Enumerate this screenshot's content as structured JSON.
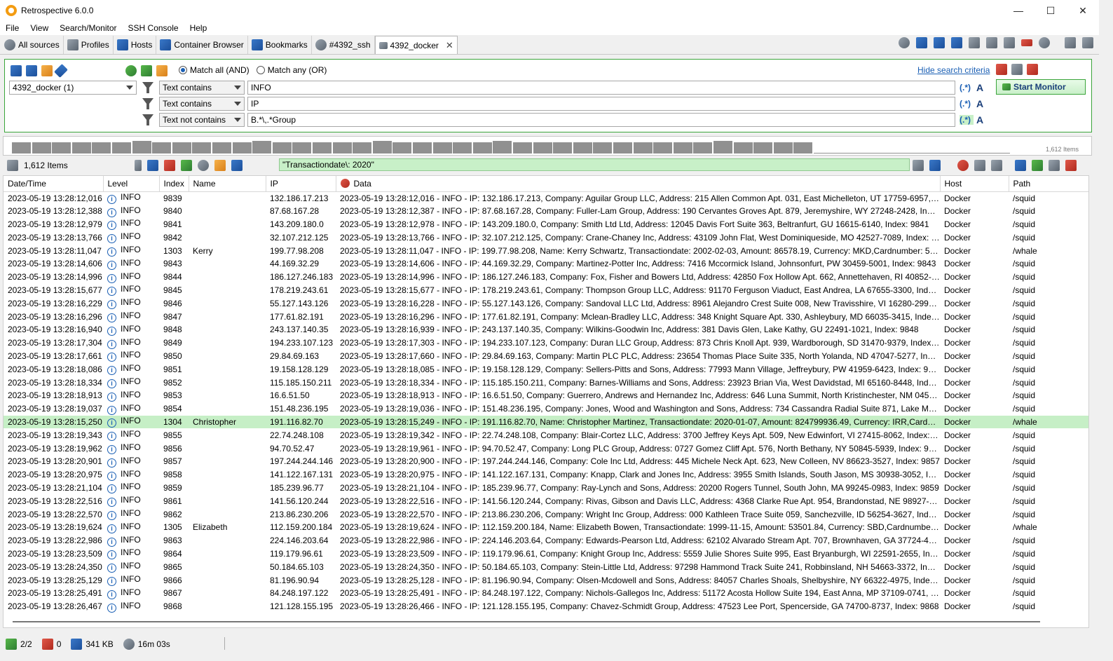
{
  "app": {
    "title": "Retrospective 6.0.0"
  },
  "menu": [
    "File",
    "View",
    "Search/Monitor",
    "SSH Console",
    "Help"
  ],
  "tabs": [
    {
      "label": "All sources",
      "icon": "search-icon"
    },
    {
      "label": "Profiles",
      "icon": "profiles-icon"
    },
    {
      "label": "Hosts",
      "icon": "hosts-icon"
    },
    {
      "label": "Container Browser",
      "icon": "container-icon"
    },
    {
      "label": "Bookmarks",
      "icon": "bookmark-icon"
    },
    {
      "label": "#4392_ssh",
      "icon": "search-icon"
    },
    {
      "label": "4392_docker",
      "icon": "list-icon",
      "active": true
    }
  ],
  "criteria": {
    "source": "4392_docker (1)",
    "match_all": "Match all (AND)",
    "match_any": "Match any (OR)",
    "hide_link": "Hide search criteria",
    "start_button": "Start Monitor",
    "filters": [
      {
        "type": "Text contains",
        "value": "INFO"
      },
      {
        "type": "Text contains",
        "value": "IP"
      },
      {
        "type": "Text not contains",
        "value": "B.*\\,.*Group"
      }
    ]
  },
  "histogram": {
    "label": "1,612 Items"
  },
  "grid": {
    "item_count": "1,612 Items",
    "search_value": "\"Transactiondate\\: 2020\"",
    "columns": [
      "Date/Time",
      "Level",
      "Index",
      "Name",
      "IP",
      "Data",
      "Host",
      "Path"
    ],
    "rows": [
      [
        "2023-05-19 13:28:12,016",
        "INFO",
        "9839",
        "",
        "132.186.17.213",
        "2023-05-19 13:28:12,016 - INFO - IP: 132.186.17.213, Company: Aguilar Group LLC, Address: 215 Allen Common Apt. 031, East Michelleton, UT 17759-6957, Index: ...",
        "Docker",
        "/squid"
      ],
      [
        "2023-05-19 13:28:12,388",
        "INFO",
        "9840",
        "",
        "87.68.167.28",
        "2023-05-19 13:28:12,387 - INFO - IP: 87.68.167.28, Company: Fuller-Lam Group, Address: 190 Cervantes Groves Apt. 879, Jeremyshire, WY 27248-2428, Index: 9840",
        "Docker",
        "/squid"
      ],
      [
        "2023-05-19 13:28:12,979",
        "INFO",
        "9841",
        "",
        "143.209.180.0",
        "2023-05-19 13:28:12,978 - INFO - IP: 143.209.180.0, Company: Smith Ltd Ltd, Address: 12045 Davis Fort Suite 363, Beltranfurt, GU 16615-6140, Index: 9841",
        "Docker",
        "/squid"
      ],
      [
        "2023-05-19 13:28:13,766",
        "INFO",
        "9842",
        "",
        "32.107.212.125",
        "2023-05-19 13:28:13,766 - INFO - IP: 32.107.212.125, Company: Crane-Chaney Inc, Address: 43109 John Flat, West Dominiqueside, MO 42527-7089, Index: 9842",
        "Docker",
        "/squid"
      ],
      [
        "2023-05-19 13:28:11,047",
        "INFO",
        "1303",
        "Kerry",
        "199.77.98.208",
        "2023-05-19 13:28:11,047 - INFO - IP: 199.77.98.208, Name: Kerry Schwartz, Transactiondate: 2002-02-03, Amount:  86578.19, Currency: MKD,Cardnumber: 50386713...",
        "Docker",
        "/whale"
      ],
      [
        "2023-05-19 13:28:14,606",
        "INFO",
        "9843",
        "",
        "44.169.32.29",
        "2023-05-19 13:28:14,606 - INFO - IP: 44.169.32.29, Company: Martinez-Potter Inc, Address: 7416 Mccormick Island, Johnsonfurt, PW 30459-5001, Index: 9843",
        "Docker",
        "/squid"
      ],
      [
        "2023-05-19 13:28:14,996",
        "INFO",
        "9844",
        "",
        "186.127.246.183",
        "2023-05-19 13:28:14,996 - INFO - IP: 186.127.246.183, Company: Fox, Fisher and Bowers Ltd, Address: 42850 Fox Hollow Apt. 662, Annettehaven, RI 40852-6600, Ind...",
        "Docker",
        "/squid"
      ],
      [
        "2023-05-19 13:28:15,677",
        "INFO",
        "9845",
        "",
        "178.219.243.61",
        "2023-05-19 13:28:15,677 - INFO - IP: 178.219.243.61, Company: Thompson Group LLC, Address: 91170 Ferguson Viaduct, East Andrea, LA 67655-3300, Index: 9845",
        "Docker",
        "/squid"
      ],
      [
        "2023-05-19 13:28:16,229",
        "INFO",
        "9846",
        "",
        "55.127.143.126",
        "2023-05-19 13:28:16,228 - INFO - IP: 55.127.143.126, Company: Sandoval LLC Ltd, Address: 8961 Alejandro Crest Suite 008, New Travisshire, VI 16280-2992, Index: 9...",
        "Docker",
        "/squid"
      ],
      [
        "2023-05-19 13:28:16,296",
        "INFO",
        "9847",
        "",
        "177.61.82.191",
        "2023-05-19 13:28:16,296 - INFO - IP: 177.61.82.191, Company: Mclean-Bradley LLC, Address: 348 Knight Square Apt. 330, Ashleybury, MD 66035-3415, Index: 9847",
        "Docker",
        "/squid"
      ],
      [
        "2023-05-19 13:28:16,940",
        "INFO",
        "9848",
        "",
        "243.137.140.35",
        "2023-05-19 13:28:16,939 - INFO - IP: 243.137.140.35, Company: Wilkins-Goodwin Inc, Address: 381 Davis Glen, Lake Kathy, GU 22491-1021, Index: 9848",
        "Docker",
        "/squid"
      ],
      [
        "2023-05-19 13:28:17,304",
        "INFO",
        "9849",
        "",
        "194.233.107.123",
        "2023-05-19 13:28:17,303 - INFO - IP: 194.233.107.123, Company: Duran LLC Group, Address: 873 Chris Knoll Apt. 939, Wardborough, SD 31470-9379, Index: 9849",
        "Docker",
        "/squid"
      ],
      [
        "2023-05-19 13:28:17,661",
        "INFO",
        "9850",
        "",
        "29.84.69.163",
        "2023-05-19 13:28:17,660 - INFO - IP: 29.84.69.163, Company: Martin PLC PLC, Address: 23654 Thomas Place Suite 335, North Yolanda, ND 47047-5277, Index: 9850",
        "Docker",
        "/squid"
      ],
      [
        "2023-05-19 13:28:18,086",
        "INFO",
        "9851",
        "",
        "19.158.128.129",
        "2023-05-19 13:28:18,085 - INFO - IP: 19.158.128.129, Company: Sellers-Pitts and Sons, Address: 77993 Mann Village, Jeffreybury, PW 41959-6423, Index: 9851",
        "Docker",
        "/squid"
      ],
      [
        "2023-05-19 13:28:18,334",
        "INFO",
        "9852",
        "",
        "115.185.150.211",
        "2023-05-19 13:28:18,334 - INFO - IP: 115.185.150.211, Company: Barnes-Williams and Sons, Address: 23923 Brian Via, West Davidstad, MI 65160-8448, Index: 9852",
        "Docker",
        "/squid"
      ],
      [
        "2023-05-19 13:28:18,913",
        "INFO",
        "9853",
        "",
        "16.6.51.50",
        "2023-05-19 13:28:18,913 - INFO - IP: 16.6.51.50, Company: Guerrero, Andrews and Hernandez Inc, Address: 646 Luna Summit, North Kristinchester, NM 04558-212...",
        "Docker",
        "/squid"
      ],
      [
        "2023-05-19 13:28:19,037",
        "INFO",
        "9854",
        "",
        "151.48.236.195",
        "2023-05-19 13:28:19,036 - INFO - IP: 151.48.236.195, Company: Jones, Wood and Washington and Sons, Address: 734 Cassandra Radial Suite 871, Lake Maryville, V...",
        "Docker",
        "/squid"
      ],
      [
        "2023-05-19 13:28:15,250",
        "INFO",
        "1304",
        "Christopher",
        "191.116.82.70",
        "2023-05-19 13:28:15,249 - INFO - IP: 191.116.82.70, Name: Christopher Martinez, Transactiondate: 2020-01-07, Amount:  824799936.49, Currency: IRR,Cardnumber: ...",
        "Docker",
        "/whale"
      ],
      [
        "2023-05-19 13:28:19,343",
        "INFO",
        "9855",
        "",
        "22.74.248.108",
        "2023-05-19 13:28:19,342 - INFO - IP: 22.74.248.108, Company: Blair-Cortez LLC, Address: 3700 Jeffrey Keys Apt. 509, New Edwinfort, VI 27415-8062, Index: 9855",
        "Docker",
        "/squid"
      ],
      [
        "2023-05-19 13:28:19,962",
        "INFO",
        "9856",
        "",
        "94.70.52.47",
        "2023-05-19 13:28:19,961 - INFO - IP: 94.70.52.47, Company: Long PLC Group, Address: 0727 Gomez Cliff Apt. 576, North Bethany, NY 50845-5939, Index: 9856",
        "Docker",
        "/squid"
      ],
      [
        "2023-05-19 13:28:20,901",
        "INFO",
        "9857",
        "",
        "197.244.244.146",
        "2023-05-19 13:28:20,900 - INFO - IP: 197.244.244.146, Company: Cole Inc Ltd, Address: 445 Michele Neck Apt. 623, New Colleen, NV 86623-3527, Index: 9857",
        "Docker",
        "/squid"
      ],
      [
        "2023-05-19 13:28:20,975",
        "INFO",
        "9858",
        "",
        "141.122.167.131",
        "2023-05-19 13:28:20,975 - INFO - IP: 141.122.167.131, Company: Knapp, Clark and Jones Inc, Address: 3955 Smith Islands, South Jason, MS 30938-3052, Index: 9858",
        "Docker",
        "/squid"
      ],
      [
        "2023-05-19 13:28:21,104",
        "INFO",
        "9859",
        "",
        "185.239.96.77",
        "2023-05-19 13:28:21,104 - INFO - IP: 185.239.96.77, Company: Ray-Lynch and Sons, Address: 20200 Rogers Tunnel, South John, MA 99245-0983, Index: 9859",
        "Docker",
        "/squid"
      ],
      [
        "2023-05-19 13:28:22,516",
        "INFO",
        "9861",
        "",
        "141.56.120.244",
        "2023-05-19 13:28:22,516 - INFO - IP: 141.56.120.244, Company: Rivas, Gibson and Davis LLC, Address: 4368 Clarke Rue Apt. 954, Brandonstad, NE 98927-5168, Inde...",
        "Docker",
        "/squid"
      ],
      [
        "2023-05-19 13:28:22,570",
        "INFO",
        "9862",
        "",
        "213.86.230.206",
        "2023-05-19 13:28:22,570 - INFO - IP: 213.86.230.206, Company: Wright Inc Group, Address: 000 Kathleen Trace Suite 059, Sanchezville, ID 56254-3627, Index: 9862",
        "Docker",
        "/squid"
      ],
      [
        "2023-05-19 13:28:19,624",
        "INFO",
        "1305",
        "Elizabeth",
        "112.159.200.184",
        "2023-05-19 13:28:19,624 - INFO - IP: 112.159.200.184, Name: Elizabeth Bowen, Transactiondate: 1999-11-15, Amount:  53501.84, Currency: SBD,Cardnumber: 44182...",
        "Docker",
        "/whale"
      ],
      [
        "2023-05-19 13:28:22,986",
        "INFO",
        "9863",
        "",
        "224.146.203.64",
        "2023-05-19 13:28:22,986 - INFO - IP: 224.146.203.64, Company: Edwards-Pearson Ltd, Address: 62102 Alvarado Stream Apt. 707, Brownhaven, GA 37724-4566, Inde...",
        "Docker",
        "/squid"
      ],
      [
        "2023-05-19 13:28:23,509",
        "INFO",
        "9864",
        "",
        "119.179.96.61",
        "2023-05-19 13:28:23,509 - INFO - IP: 119.179.96.61, Company: Knight Group Inc, Address: 5559 Julie Shores Suite 995, East Bryanburgh, WI 22591-2655, Index: 9864",
        "Docker",
        "/squid"
      ],
      [
        "2023-05-19 13:28:24,350",
        "INFO",
        "9865",
        "",
        "50.184.65.103",
        "2023-05-19 13:28:24,350 - INFO - IP: 50.184.65.103, Company: Stein-Little Ltd, Address: 97298 Hammond Track Suite 241, Robbinsland, NH 54663-3372, Index: 9865",
        "Docker",
        "/squid"
      ],
      [
        "2023-05-19 13:28:25,129",
        "INFO",
        "9866",
        "",
        "81.196.90.94",
        "2023-05-19 13:28:25,128 - INFO - IP: 81.196.90.94, Company: Olsen-Mcdowell and Sons, Address: 84057 Charles Shoals, Shelbyshire, NY 66322-4975, Index: 9866",
        "Docker",
        "/squid"
      ],
      [
        "2023-05-19 13:28:25,491",
        "INFO",
        "9867",
        "",
        "84.248.197.122",
        "2023-05-19 13:28:25,491 - INFO - IP: 84.248.197.122, Company: Nichols-Gallegos Inc, Address: 51172 Acosta Hollow Suite 194, East Anna, MP 37109-0741, Index: 98...",
        "Docker",
        "/squid"
      ],
      [
        "2023-05-19 13:28:26,467",
        "INFO",
        "9868",
        "",
        "121.128.155.195",
        "2023-05-19 13:28:26,466 - INFO - IP: 121.128.155.195, Company: Chavez-Schmidt Group, Address: 47523 Lee Port, Spencerside, GA 74700-8737, Index: 9868",
        "Docker",
        "/squid"
      ]
    ],
    "selected_row": 17
  },
  "status": {
    "sources": "2/2",
    "errors": "0",
    "size": "341 KB",
    "elapsed": "16m 03s"
  }
}
